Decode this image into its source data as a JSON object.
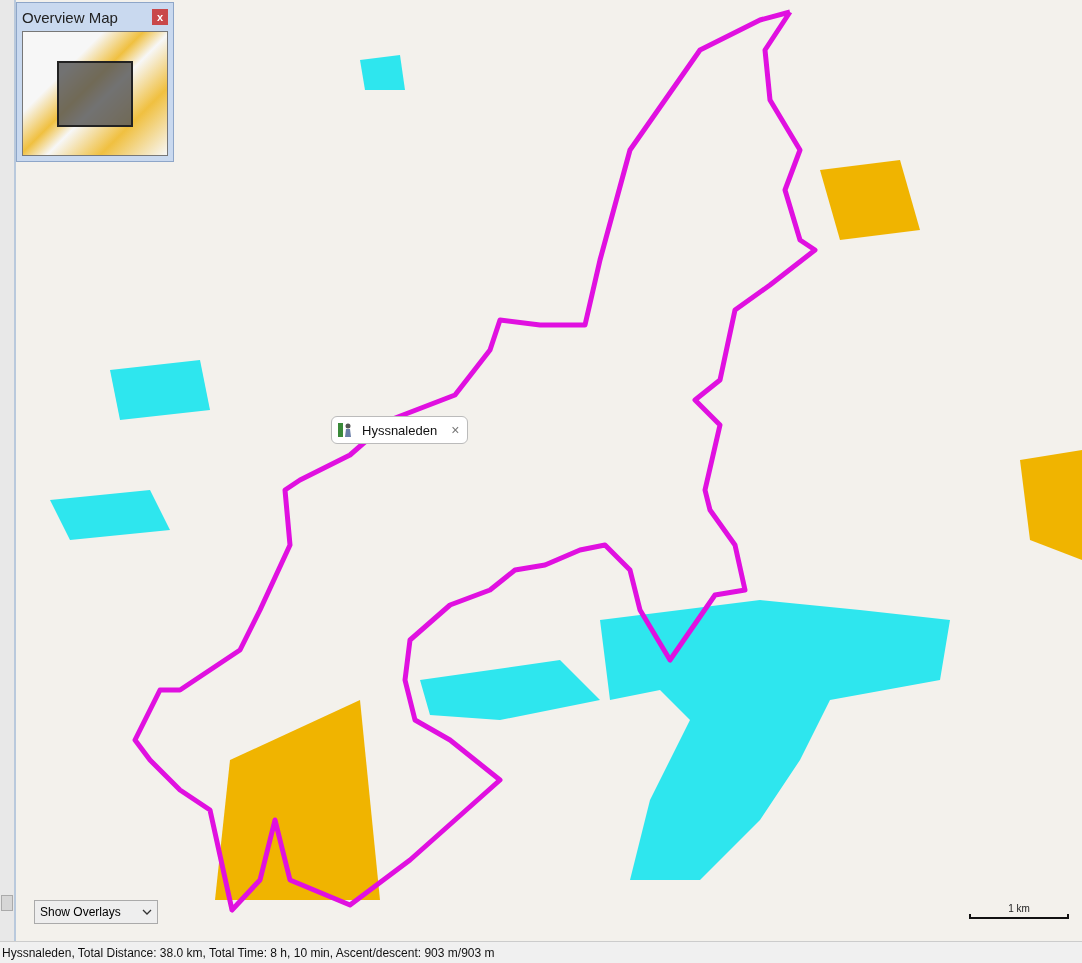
{
  "overview_map": {
    "title": "Overview Map",
    "close": "x"
  },
  "route_tooltip": {
    "label": "Hyssnaleden",
    "close": "×"
  },
  "overlays_dropdown": {
    "value": "Show Overlays"
  },
  "scale_bar": {
    "label": "1 km"
  },
  "status_bar": {
    "text": "Hyssnaleden, Total Distance: 38.0 km, Total Time: 8 h, 10 min, Ascent/descent: 903 m/903 m"
  }
}
